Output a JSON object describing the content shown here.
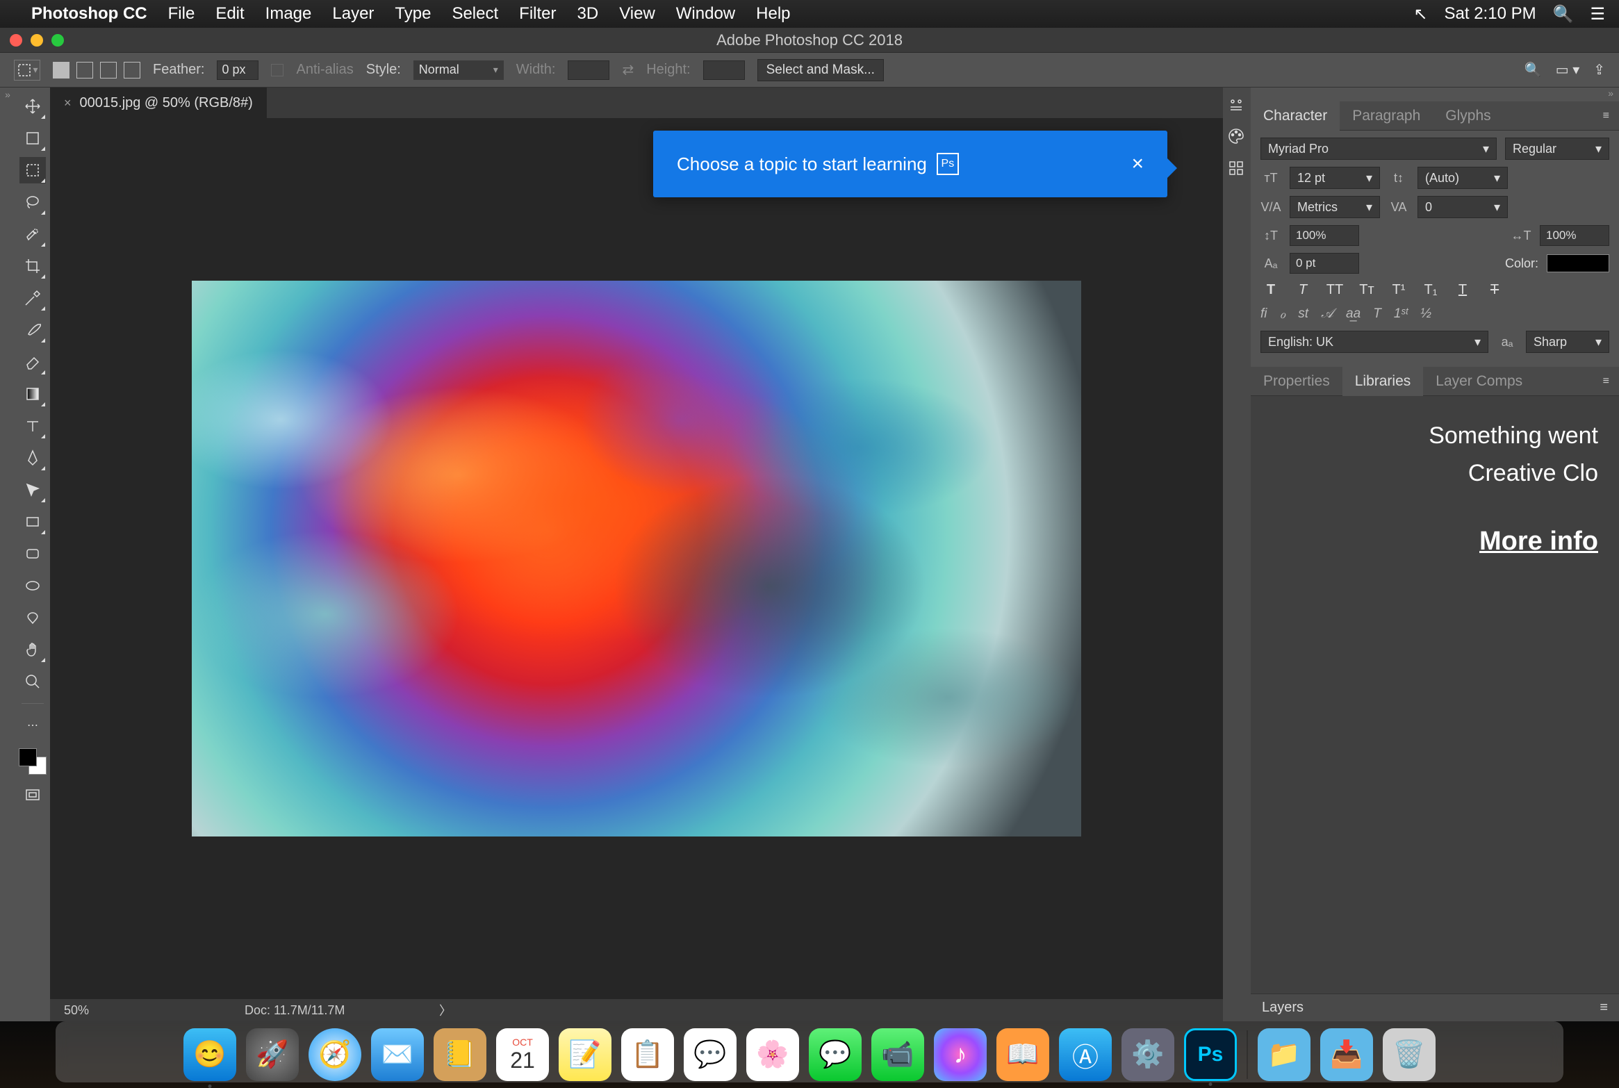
{
  "menubar": {
    "app": "Photoshop CC",
    "items": [
      "File",
      "Edit",
      "Image",
      "Layer",
      "Type",
      "Select",
      "Filter",
      "3D",
      "View",
      "Window",
      "Help"
    ],
    "clock": "Sat 2:10 PM"
  },
  "window": {
    "title": "Adobe Photoshop CC 2018"
  },
  "options": {
    "feather_label": "Feather:",
    "feather_value": "0 px",
    "antialias_label": "Anti-alias",
    "style_label": "Style:",
    "style_value": "Normal",
    "width_label": "Width:",
    "height_label": "Height:",
    "select_mask": "Select and Mask..."
  },
  "document": {
    "tab": "00015.jpg @ 50% (RGB/8#)",
    "zoom": "50%",
    "docinfo": "Doc: 11.7M/11.7M"
  },
  "tooltip": {
    "text": "Choose a topic to start learning",
    "badge": "Ps"
  },
  "char_panel": {
    "tabs": [
      "Character",
      "Paragraph",
      "Glyphs"
    ],
    "font": "Myriad Pro",
    "style": "Regular",
    "size": "12 pt",
    "leading": "(Auto)",
    "kerning": "Metrics",
    "tracking": "0",
    "vscale": "100%",
    "hscale": "100%",
    "baseline": "0 pt",
    "color_label": "Color:",
    "language": "English: UK",
    "aa": "Sharp"
  },
  "lib_panel": {
    "tabs": [
      "Properties",
      "Libraries",
      "Layer Comps"
    ],
    "error_line1": "Something went ",
    "error_line2": "Creative Clo",
    "more": "More info"
  },
  "layers": {
    "tab": "Layers"
  },
  "dock": {
    "calendar_month": "OCT",
    "calendar_day": "21",
    "ps_label": "Ps"
  }
}
